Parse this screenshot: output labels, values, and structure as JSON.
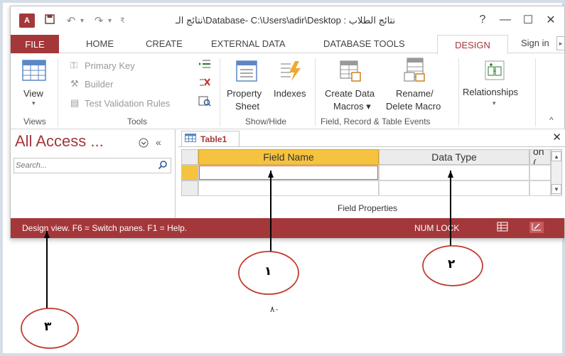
{
  "titlebar": {
    "logo": "A",
    "title": "نتائج الـ\\Database- C:\\Users\\adir\\Desktop : نتائج الطلاب",
    "help": "?",
    "minimize": "—",
    "maximize": "☐",
    "close": "✕"
  },
  "tabs": {
    "file": "FILE",
    "items": [
      "HOME",
      "CREATE",
      "EXTERNAL DATA",
      "DATABASE TOOLS"
    ],
    "design": "DESIGN",
    "signin": "Sign in"
  },
  "ribbon": {
    "views": {
      "view_label": "View",
      "group": "Views"
    },
    "tools": {
      "primary_key": "Primary Key",
      "builder": "Builder",
      "test_validation": "Test Validation Rules",
      "group": "Tools"
    },
    "showhide": {
      "property_sheet_1": "Property",
      "property_sheet_2": "Sheet",
      "indexes": "Indexes",
      "group": "Show/Hide"
    },
    "events": {
      "create_macros_1": "Create Data",
      "create_macros_2": "Macros ▾",
      "rename_1": "Rename/",
      "rename_2": "Delete Macro",
      "group": "Field, Record & Table Events"
    },
    "relationships": {
      "label": "Relationships",
      "arrow": "▾"
    },
    "collapse": "^"
  },
  "nav": {
    "title": "All Access ...",
    "search_placeholder": "Search..."
  },
  "document": {
    "tab_label": "Table1",
    "close": "✕",
    "columns": [
      "Field Name",
      "Data Type",
      "on ("
    ],
    "field_properties": "Field Properties"
  },
  "statusbar": {
    "text": "Design view.  F6 = Switch panes.  F1 = Help.",
    "numlock": "NUM LOCK"
  },
  "annotations": {
    "label_1": "١",
    "label_2": "٢",
    "label_3": "٣",
    "page_number": "٨٠"
  },
  "colors": {
    "accent": "#a4373a",
    "header_highlight": "#f5c33f"
  }
}
